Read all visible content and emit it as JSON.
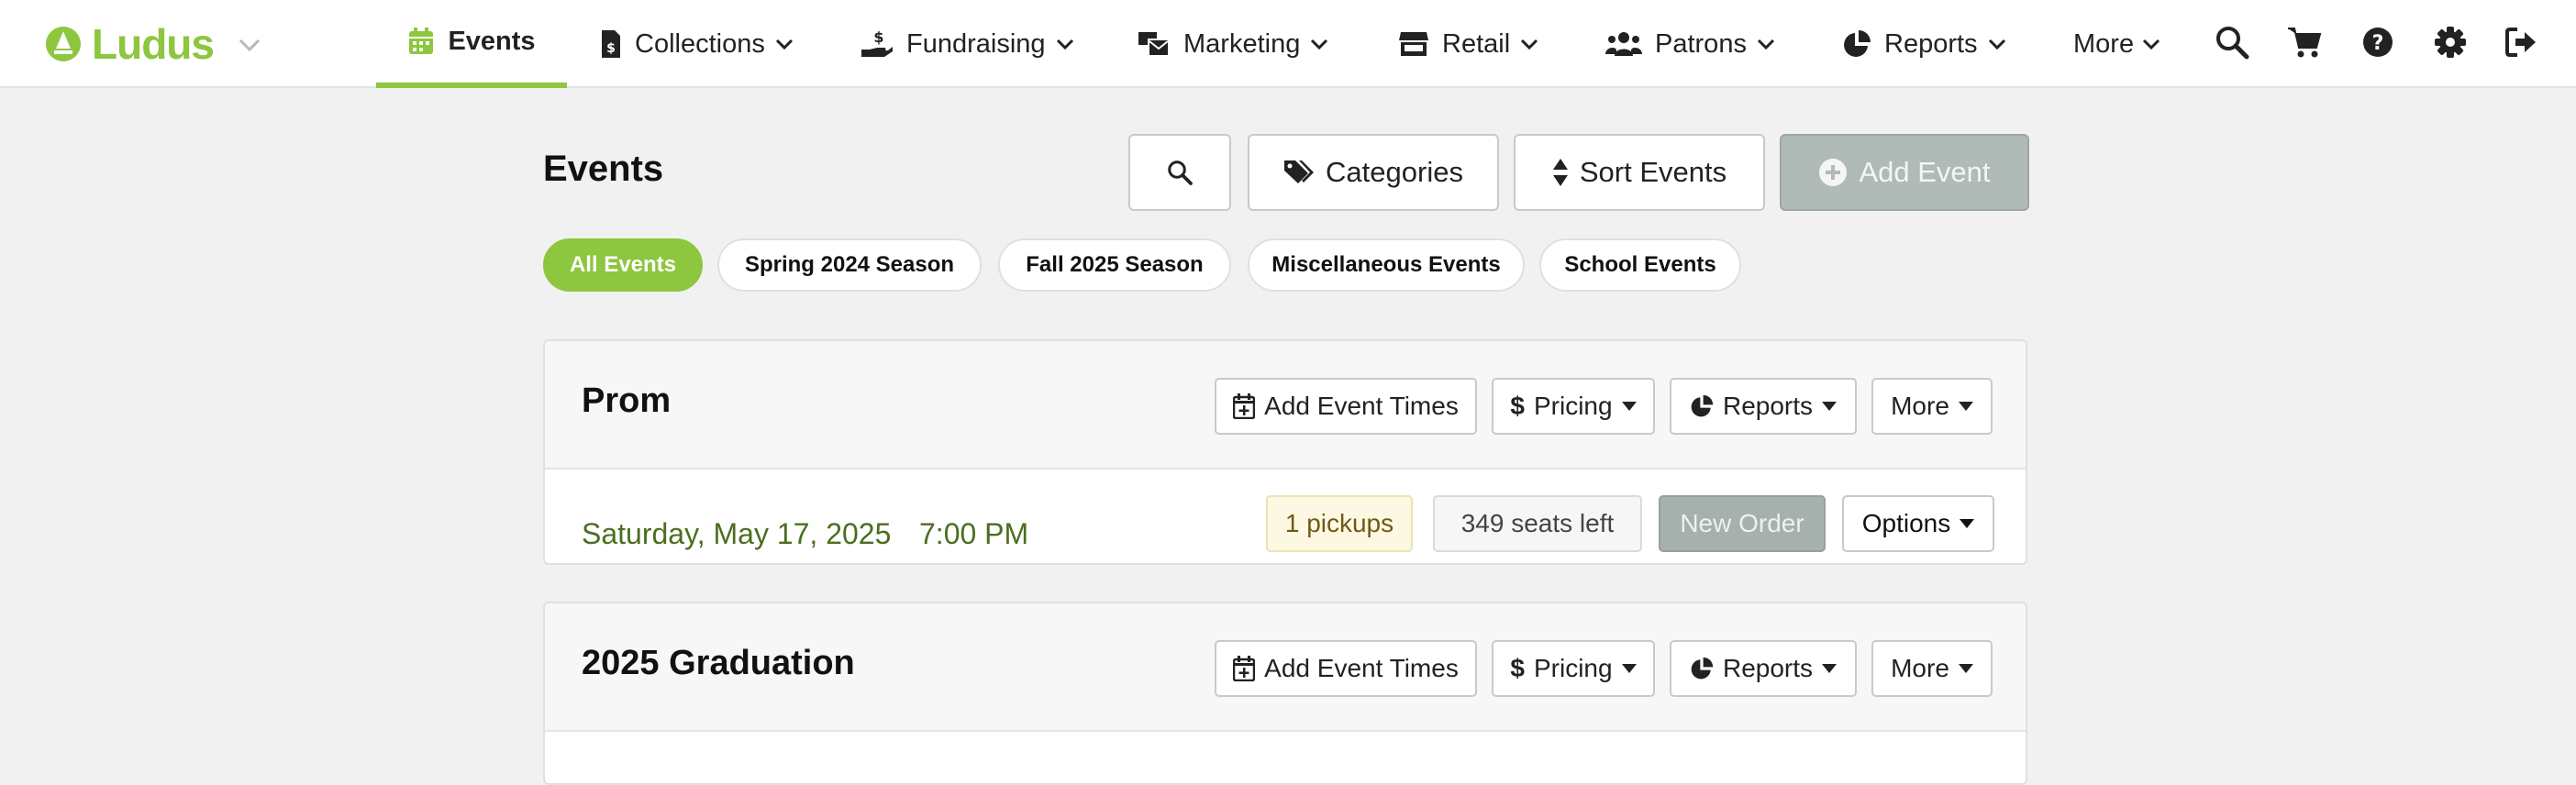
{
  "brand": {
    "name": "Ludus",
    "color": "#8dc63f"
  },
  "nav": {
    "items": [
      {
        "label": "Events",
        "icon": "calendar-icon",
        "active": true
      },
      {
        "label": "Collections",
        "icon": "invoice-icon"
      },
      {
        "label": "Fundraising",
        "icon": "hand-dollar-icon"
      },
      {
        "label": "Marketing",
        "icon": "mail-bulk-icon"
      },
      {
        "label": "Retail",
        "icon": "store-icon"
      },
      {
        "label": "Patrons",
        "icon": "users-icon"
      },
      {
        "label": "Reports",
        "icon": "pie-chart-icon"
      },
      {
        "label": "More",
        "icon": ""
      }
    ],
    "right_icons": [
      "search-icon",
      "cart-icon",
      "help-icon",
      "gear-icon",
      "sign-out-icon"
    ]
  },
  "page": {
    "title": "Events",
    "search_icon": "search-icon",
    "categories_label": "Categories",
    "sort_label": "Sort Events",
    "add_event_label": "Add Event"
  },
  "filters": [
    "All Events",
    "Spring 2024 Season",
    "Fall 2025 Season",
    "Miscellaneous Events",
    "School Events"
  ],
  "events": [
    {
      "title": "Prom",
      "buttons": {
        "add_times": "Add Event Times",
        "pricing": "Pricing",
        "reports": "Reports",
        "more": "More"
      },
      "date": "Saturday, May 17, 2025",
      "time": "7:00 PM",
      "pickups": "1 pickups",
      "seats": "349 seats left",
      "new_order": "New Order",
      "options": "Options"
    },
    {
      "title": "2025 Graduation",
      "buttons": {
        "add_times": "Add Event Times",
        "pricing": "Pricing",
        "reports": "Reports",
        "more": "More"
      }
    }
  ],
  "colors": {
    "accent": "#8dc63f",
    "date_text": "#4b6e1f",
    "disabled_button": "#b0bab6"
  }
}
